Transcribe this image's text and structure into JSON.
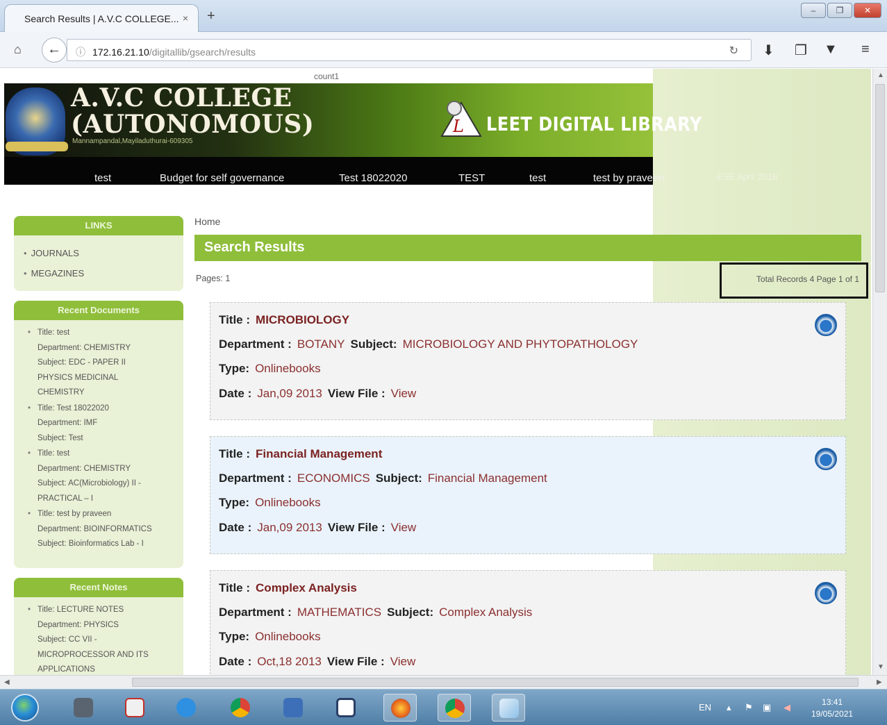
{
  "browser": {
    "tab_title": "Search Results | A.V.C COLLEGE...",
    "tab_close": "×",
    "new_tab": "+",
    "url_host": "172.16.21.10",
    "url_path": "/digitallib/gsearch/results"
  },
  "page": {
    "counter": "count1",
    "college_name_line1": "A.V.C COLLEGE",
    "college_name_line2": "(AUTONOMOUS)",
    "college_address": "Mannampandal,Mayiladuthurai-609305",
    "library_title": "LEET DIGITAL LIBRARY",
    "menu": [
      "test",
      "Budget for self governance",
      "Test 18022020",
      "TEST",
      "test",
      "test by praveen",
      "ESE April 2018"
    ],
    "breadcrumb": "Home",
    "results_heading": "Search Results",
    "pages_label": "Pages: 1",
    "totals_label": "Total Records 4   Page 1 of 1"
  },
  "sidebar": {
    "links_title": "LINKS",
    "links": [
      "JOURNALS",
      "MEGAZINES"
    ],
    "recent_docs_title": "Recent Documents",
    "recent_docs": [
      [
        "Title: test",
        "Department: CHEMISTRY",
        "Subject: EDC - PAPER II",
        "PHYSICS MEDICINAL",
        "CHEMISTRY"
      ],
      [
        "Title: Test 18022020",
        "Department: IMF",
        "Subject: Test"
      ],
      [
        "Title: test",
        "Department: CHEMISTRY",
        "Subject: AC(Microbiology) II -",
        "PRACTICAL – I"
      ],
      [
        "Title: test by praveen",
        "Department: BIOINFORMATICS",
        "Subject: Bioinformatics Lab - I"
      ]
    ],
    "recent_notes_title": "Recent Notes",
    "recent_notes": [
      [
        "Title: LECTURE NOTES",
        "Department: PHYSICS",
        "Subject: CC VII -",
        "MICROPROCESSOR AND ITS",
        "APPLICATIONS"
      ]
    ]
  },
  "labels": {
    "title": "Title :",
    "department": "Department :",
    "subject": "Subject:",
    "type": "Type:",
    "date": "Date :",
    "view_file": "View File :"
  },
  "results": [
    {
      "title": "MICROBIOLOGY",
      "department": "BOTANY",
      "subject": "MICROBIOLOGY AND PHYTOPATHOLOGY",
      "type": "Onlinebooks",
      "date": "Jan,09 2013",
      "view": "View"
    },
    {
      "title": "Financial Management",
      "department": "ECONOMICS",
      "subject": "Financial Management",
      "type": "Onlinebooks",
      "date": "Jan,09 2013",
      "view": "View"
    },
    {
      "title": "Complex Analysis",
      "department": "MATHEMATICS",
      "subject": "Complex Analysis",
      "type": "Onlinebooks",
      "date": "Oct,18 2013",
      "view": "View"
    }
  ],
  "taskbar": {
    "lang": "EN",
    "time": "13:41",
    "date": "19/05/2021"
  },
  "colors": {
    "accent_green": "#8fbe3b",
    "value_red": "#8b2f2f"
  }
}
